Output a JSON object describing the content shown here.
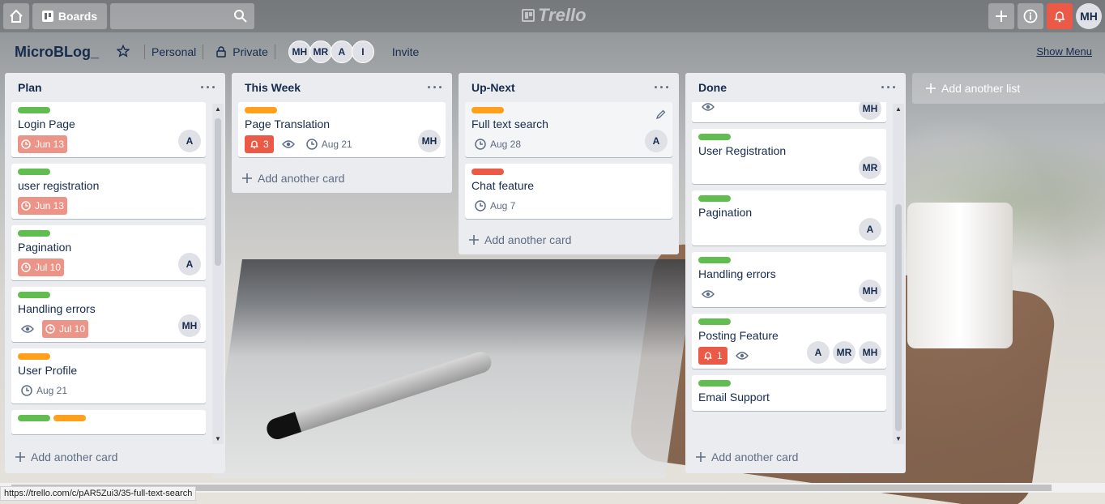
{
  "topbar": {
    "boards_label": "Boards",
    "logo_text": "Trello"
  },
  "account": {
    "initials": "MH"
  },
  "board": {
    "title": "MicroBLog_",
    "team": "Personal",
    "visibility": "Private",
    "members": [
      "MH",
      "MR",
      "A",
      "I"
    ],
    "invite_label": "Invite",
    "show_menu_label": "Show Menu"
  },
  "add_card_label": "Add another card",
  "add_list_label": "Add another list",
  "lists": [
    {
      "name": "Plan",
      "cards": [
        {
          "labels": [
            "green"
          ],
          "title": "Login Page",
          "due": "Jun 13",
          "members": [
            "A"
          ]
        },
        {
          "labels": [
            "green"
          ],
          "title": "user registration",
          "due": "Jun 13",
          "members": []
        },
        {
          "labels": [
            "green"
          ],
          "title": "Pagination",
          "due": "Jul 10",
          "members": [
            "A"
          ]
        },
        {
          "labels": [
            "green"
          ],
          "title": "Handling errors",
          "due": "Jul 10",
          "members": [
            "MH"
          ]
        },
        {
          "labels": [
            "orange"
          ],
          "title": "User Profile",
          "due": "Aug 21",
          "members": []
        }
      ]
    },
    {
      "name": "This Week",
      "cards": [
        {
          "labels": [
            "orange"
          ],
          "title": "Page Translation",
          "notifications": "3",
          "due": "Aug 21",
          "members": [
            "MH"
          ]
        }
      ]
    },
    {
      "name": "Up-Next",
      "cards": [
        {
          "labels": [
            "orange"
          ],
          "title": "Full text search",
          "due": "Aug 28",
          "members": [
            "A"
          ]
        },
        {
          "labels": [
            "red"
          ],
          "title": "Chat feature",
          "due": "Aug 7",
          "members": []
        }
      ]
    },
    {
      "name": "Done",
      "cards": [
        {
          "labels": [],
          "title": "",
          "members": [
            "MH"
          ]
        },
        {
          "labels": [
            "green"
          ],
          "title": "User Registration",
          "members": [
            "MR"
          ]
        },
        {
          "labels": [
            "green"
          ],
          "title": "Pagination",
          "members": [
            "A"
          ]
        },
        {
          "labels": [
            "green"
          ],
          "title": "Handling errors",
          "members": [
            "MH"
          ]
        },
        {
          "labels": [
            "green"
          ],
          "title": "Posting Feature",
          "notifications": "1",
          "members": [
            "A",
            "MR",
            "MH"
          ]
        },
        {
          "labels": [
            "green"
          ],
          "title": "Email Support",
          "members": []
        }
      ]
    }
  ],
  "status_url": "https://trello.com/c/pAR5Zui3/35-full-text-search",
  "colors": {
    "label_green": "#61bd4f",
    "label_orange": "#ff9f1a",
    "label_red": "#eb5a46",
    "due_overdue": "#ec9488",
    "list_bg": "#ebecf0"
  },
  "icons": [
    "home-icon",
    "boards-icon",
    "search-icon",
    "plus-icon",
    "info-icon",
    "bell-icon",
    "star-icon",
    "lock-icon",
    "clock-icon",
    "eye-icon",
    "pencil-icon",
    "ellipsis-icon"
  ]
}
